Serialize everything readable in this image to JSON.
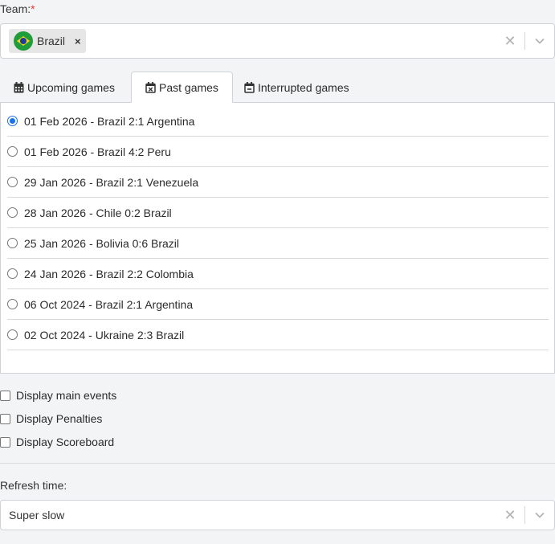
{
  "team_field": {
    "label": "Team:",
    "required_mark": "*",
    "selected_chip": {
      "text": "Brazil",
      "flag_icon": "brazil-flag-icon",
      "remove_glyph": "×"
    },
    "clear_glyph": "✕",
    "chevron_icon": "chevron-down-icon"
  },
  "tabs": [
    {
      "label": "Upcoming games",
      "icon": "calendar-icon",
      "active": false
    },
    {
      "label": "Past games",
      "icon": "calendar-x-icon",
      "active": true
    },
    {
      "label": "Interrupted games",
      "icon": "calendar-minus-icon",
      "active": false
    }
  ],
  "games": [
    {
      "label": "01 Feb 2026 - Brazil 2:1 Argentina",
      "selected": true
    },
    {
      "label": "01 Feb 2026 - Brazil 4:2 Peru",
      "selected": false
    },
    {
      "label": "29 Jan 2026 - Brazil 2:1 Venezuela",
      "selected": false
    },
    {
      "label": "28 Jan 2026 - Chile 0:2 Brazil",
      "selected": false
    },
    {
      "label": "25 Jan 2026 - Bolivia 0:6 Brazil",
      "selected": false
    },
    {
      "label": "24 Jan 2026 - Brazil 2:2 Colombia",
      "selected": false
    },
    {
      "label": "06 Oct 2024 - Brazil 2:1 Argentina",
      "selected": false
    },
    {
      "label": "02 Oct 2024 - Ukraine 2:3 Brazil",
      "selected": false
    }
  ],
  "options": [
    {
      "label": "Display main events",
      "checked": false
    },
    {
      "label": "Display Penalties",
      "checked": false
    },
    {
      "label": "Display Scoreboard",
      "checked": false
    }
  ],
  "refresh_field": {
    "label": "Refresh time:",
    "value": "Super slow",
    "clear_glyph": "✕",
    "chevron_icon": "chevron-down-icon"
  },
  "colors": {
    "accent": "#1a73e8",
    "required": "#e53935",
    "background": "#f3f4f6",
    "border": "#cfd3d8"
  }
}
